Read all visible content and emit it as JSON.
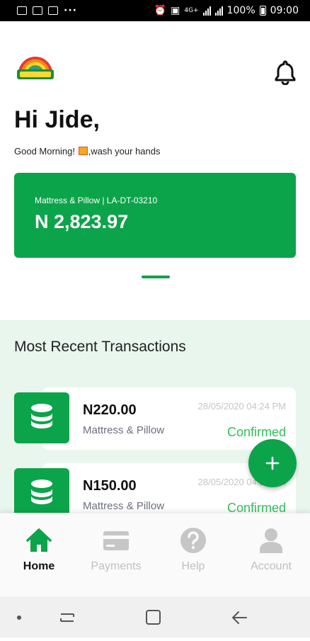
{
  "status_bar": {
    "network": "4G+",
    "battery": "100%",
    "time": "09:00",
    "overflow": "···"
  },
  "header": {
    "logo_icon": "mouka-logo-icon",
    "notification_icon": "bell-icon"
  },
  "greeting": {
    "title": "Hi Jide,",
    "message_before": "Good Morning! ",
    "message_after": ",wash your hands"
  },
  "account_card": {
    "label": "Mattress & Pillow | LA-DT-03210",
    "amount": "N 2,823.97",
    "color": "#0ca44a"
  },
  "recent_transactions": {
    "title": "Most Recent Transactions",
    "items": [
      {
        "amount": "N220.00",
        "description": "Mattress & Pillow",
        "date": "28/05/2020 04:24 PM",
        "status": "Confirmed",
        "icon": "coins-icon"
      },
      {
        "amount": "N150.00",
        "description": "Mattress & Pillow",
        "date": "28/05/2020 04:24 PM",
        "status": "Confirmed",
        "icon": "coins-icon"
      }
    ]
  },
  "fab": {
    "label": "+",
    "icon": "plus-icon"
  },
  "bottom_nav": {
    "items": [
      {
        "label": "Home",
        "icon": "home-icon",
        "active": true
      },
      {
        "label": "Payments",
        "icon": "credit-card-icon",
        "active": false
      },
      {
        "label": "Help",
        "icon": "help-icon",
        "active": false
      },
      {
        "label": "Account",
        "icon": "person-icon",
        "active": false
      }
    ]
  },
  "colors": {
    "primary": "#0ca44a",
    "status_confirmed": "#2fbf5a",
    "section_bg": "#e9f6ee"
  }
}
